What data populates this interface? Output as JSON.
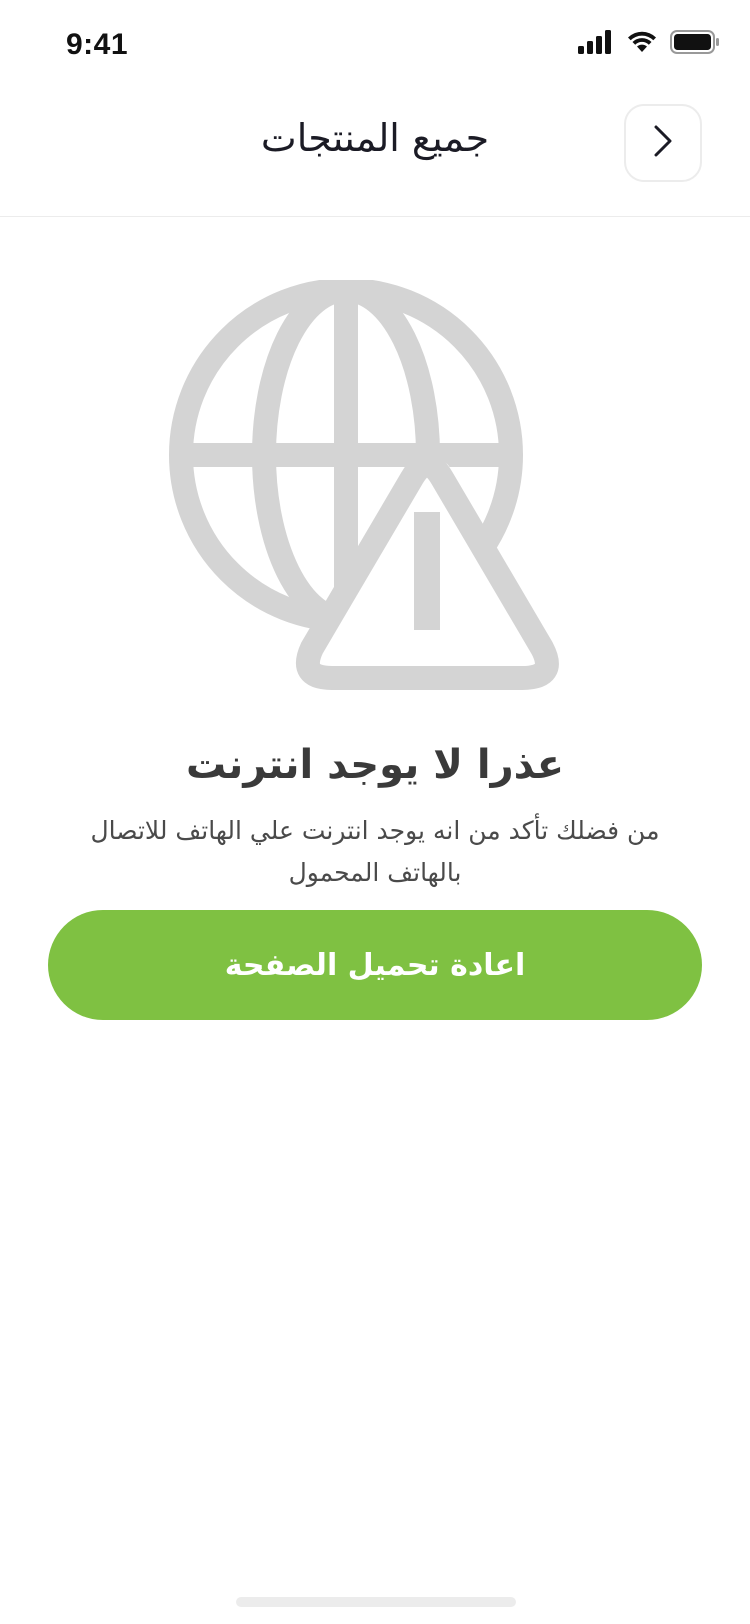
{
  "status_bar": {
    "time": "9:41",
    "icons": [
      "cellular-signal-icon",
      "wifi-icon",
      "battery-icon"
    ]
  },
  "header": {
    "title": "جميع المنتجات",
    "back_icon": "chevron-right-icon"
  },
  "illustration": {
    "icon": "globe-warning-icon",
    "color": "#d4d4d4"
  },
  "error": {
    "title": "عذرا لا يوجد انترنت",
    "message": "من فضلك تأكد من انه يوجد انترنت علي الهاتف للاتصال بالهاتف المحمول"
  },
  "reload_button": {
    "label": "اعادة تحميل الصفحة",
    "color": "#7fc142"
  }
}
